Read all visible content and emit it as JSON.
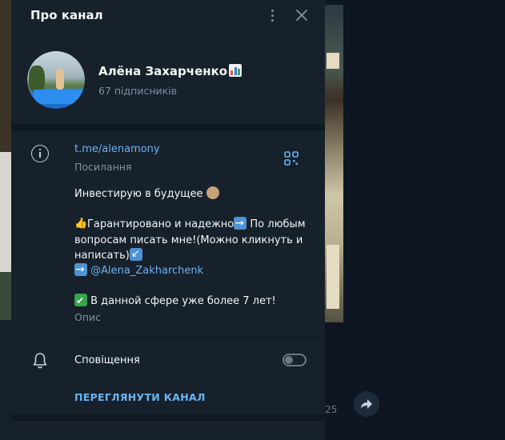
{
  "panel": {
    "title": "Про канал"
  },
  "channel": {
    "name": "Алёна Захарченко",
    "subscribers": "67 підписників"
  },
  "link": {
    "url": "t.me/alenamony",
    "caption": "Посилання"
  },
  "description": {
    "line1": "Инвестирую в будущее",
    "line2": "Гарантировано и надежно",
    "line2b": " По любым",
    "line3": "вопросам писать мне!(Можно кликнуть и",
    "line4": "написать)",
    "mention": "@Alena_Zakharchenk",
    "line6": " В данной сфере уже более 7 лет!",
    "caption": "Опис"
  },
  "notifications": {
    "label": "Сповіщення",
    "enabled": false
  },
  "actions": {
    "view_channel": "ПЕРЕГЛЯНУТИ КАНАЛ"
  },
  "background": {
    "time": "25"
  },
  "colors": {
    "panel_bg": "#17212b",
    "accent": "#6ab3f3",
    "muted": "#7f91a4"
  }
}
